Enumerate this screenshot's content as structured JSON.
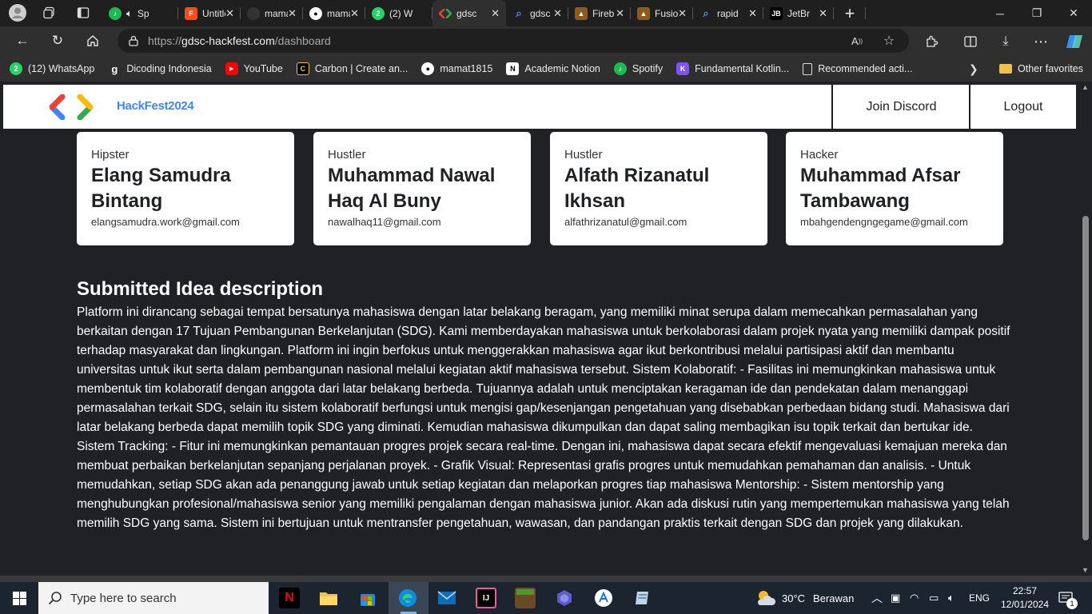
{
  "browser": {
    "tabs": [
      {
        "title": "Spotify",
        "fav_color": "#1db954",
        "fav_glyph": "♪",
        "icon": "spotify-icon"
      },
      {
        "title": "Untitled",
        "fav_color": "#f24e1e",
        "fav_glyph": "F",
        "icon": "figma-icon"
      },
      {
        "title": "mamat",
        "fav_color": "#333333",
        "fav_glyph": "◯",
        "icon": "github-icon"
      },
      {
        "title": "mamat",
        "fav_color": "#24292f",
        "fav_glyph": "◯",
        "icon": "github-icon"
      },
      {
        "title": "(2) W",
        "fav_color": "#25d366",
        "fav_glyph": "2",
        "icon": "whatsapp-icon"
      },
      {
        "title": "gdsc",
        "fav_color": "#2f2f2f",
        "fav_glyph": "<>",
        "icon": "gdsc-icon",
        "active": true
      },
      {
        "title": "gdsc",
        "fav_color": "#1a73e8",
        "fav_glyph": "⌕",
        "icon": "search-icon"
      },
      {
        "title": "Fireb",
        "fav_color": "#8d5a1e",
        "fav_glyph": "▲",
        "icon": "firebase-icon"
      },
      {
        "title": "Fusio",
        "fav_color": "#8d5a1e",
        "fav_glyph": "▲",
        "icon": "firebase-icon"
      },
      {
        "title": "rapid",
        "fav_color": "#1a73e8",
        "fav_glyph": "⌕",
        "icon": "search-icon"
      },
      {
        "title": "JetBr",
        "fav_color": "#000000",
        "fav_glyph": "JB",
        "icon": "jetbrains-icon"
      }
    ],
    "url_scheme": "https://",
    "url_host": "gdsc-hackfest.com",
    "url_path": "/dashboard",
    "bookmarks": [
      {
        "label": "(12) WhatsApp",
        "color": "#25d366",
        "glyph": "2",
        "icon": "whatsapp-icon"
      },
      {
        "label": "Dicoding Indonesia",
        "color": "#2f2f2f",
        "glyph": "g",
        "icon": "dicoding-icon"
      },
      {
        "label": "YouTube",
        "color": "#ff0000",
        "glyph": "▶",
        "icon": "youtube-icon"
      },
      {
        "label": "Carbon | Create an...",
        "color": "#000000",
        "glyph": "C",
        "icon": "carbon-icon"
      },
      {
        "label": "mamat1815",
        "color": "#24292f",
        "glyph": "◯",
        "icon": "github-icon"
      },
      {
        "label": "Academic Notion",
        "color": "#ffffff",
        "glyph": "N",
        "icon": "notion-icon"
      },
      {
        "label": "Spotify",
        "color": "#1db954",
        "glyph": "♪",
        "icon": "spotify-icon"
      },
      {
        "label": "Fundamental Kotlin...",
        "color": "#7f52ff",
        "glyph": "K",
        "icon": "kotlin-icon"
      },
      {
        "label": "Recommended acti...",
        "color": "#2f2f2f",
        "glyph": "▭",
        "icon": "document-icon"
      }
    ],
    "other_favorites": "Other favorites"
  },
  "site": {
    "name": "HackFest2024",
    "join_discord": "Join Discord",
    "logout": "Logout"
  },
  "members": [
    {
      "role": "Hipster",
      "name": "Elang Samudra Bintang",
      "email": "elangsamudra.work@gmail.com"
    },
    {
      "role": "Hustler",
      "name": "Muhammad Nawal Haq Al Buny",
      "email": "nawalhaq11@gmail.com"
    },
    {
      "role": "Hustler",
      "name": "Alfath Rizanatul Ikhsan",
      "email": "alfathrizanatul@gmail.com"
    },
    {
      "role": "Hacker",
      "name": "Muhammad Afsar Tambawang",
      "email": "mbahgendengngegame@gmail.com"
    }
  ],
  "idea": {
    "title": "Submitted Idea description",
    "description": "Platform ini dirancang sebagai tempat bersatunya mahasiswa dengan latar belakang beragam, yang memiliki minat serupa dalam memecahkan permasalahan yang berkaitan dengan 17 Tujuan Pembangunan Berkelanjutan (SDG). Kami memberdayakan mahasiswa untuk berkolaborasi dalam projek nyata yang memiliki dampak positif terhadap masyarakat dan lingkungan. Platform ini ingin berfokus untuk menggerakkan mahasiswa agar ikut berkontribusi melalui partisipasi aktif dan membantu universitas untuk ikut serta dalam pembangunan nasional melalui kegiatan aktif mahasiswa tersebut. Sistem Kolaboratif: - Fasilitas ini memungkinkan mahasiswa untuk membentuk tim kolaboratif dengan anggota dari latar belakang berbeda. Tujuannya adalah untuk menciptakan keragaman ide dan pendekatan dalam menanggapi permasalahan terkait SDG, selain itu sistem kolaboratif berfungsi untuk mengisi gap/kesenjangan pengetahuan yang disebabkan perbedaan bidang studi. Mahasiswa dari latar belakang berbeda dapat memilih topik SDG yang diminati. Kemudian mahasiswa dikumpulkan dan dapat saling membagikan isu topik terkait dan bertukar ide. Sistem Tracking: - Fitur ini memungkinkan pemantauan progres projek secara real-time. Dengan ini, mahasiswa dapat secara efektif mengevaluasi kemajuan mereka dan membuat perbaikan berkelanjutan sepanjang perjalanan proyek. - Grafik Visual: Representasi grafis progres untuk memudahkan pemahaman dan analisis. - Untuk memudahkan, setiap SDG akan ada penanggung jawab untuk setiap kegiatan dan melaporkan progres tiap mahasiswa Mentorship: - Sistem mentorship yang menghubungkan profesional/mahasiswa senior yang memiliki pengalaman dengan mahasiswa junior. Akan ada diskusi rutin yang mempertemukan mahasiswa yang telah memilih SDG yang sama. Sistem ini bertujuan untuk mentransfer pengetahuan, wawasan, dan pandangan praktis terkait dengan SDG dan projek yang dilakukan."
  },
  "taskbar": {
    "search_placeholder": "Type here to search",
    "weather_temp": "30°C",
    "weather_desc": "Berawan",
    "language": "ENG",
    "time": "22:57",
    "date": "12/01/2024",
    "notification_count": "1"
  }
}
